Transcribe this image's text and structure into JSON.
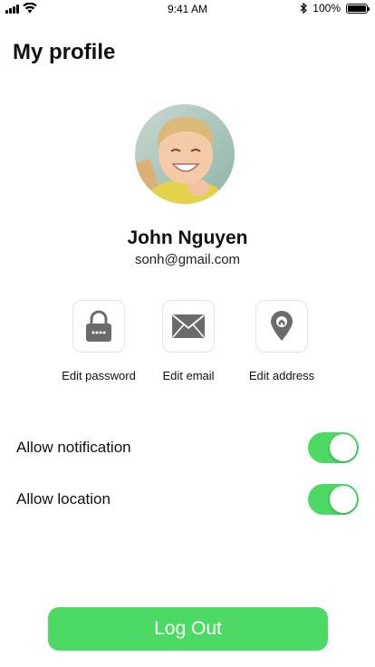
{
  "status_bar": {
    "time": "9:41 AM",
    "battery_percent": "100%",
    "battery_level": 1.0,
    "icons": [
      "signal-icon",
      "wifi-icon",
      "bluetooth-icon",
      "battery-icon"
    ]
  },
  "header": {
    "title": "My profile"
  },
  "profile": {
    "avatar_icon": "avatar",
    "name": "John Nguyen",
    "email": "sonh@gmail.com"
  },
  "actions": [
    {
      "label": "Edit password",
      "icon": "lock-icon"
    },
    {
      "label": "Edit email",
      "icon": "envelope-icon"
    },
    {
      "label": "Edit address",
      "icon": "location-pin-icon"
    }
  ],
  "settings": [
    {
      "label": "Allow notification",
      "enabled": true
    },
    {
      "label": "Allow location",
      "enabled": true
    }
  ],
  "logout": {
    "label": "Log Out"
  },
  "colors": {
    "accent": "#4cd964",
    "icon_gray": "#6b6b6b",
    "tile_border": "#e4e4e4"
  }
}
